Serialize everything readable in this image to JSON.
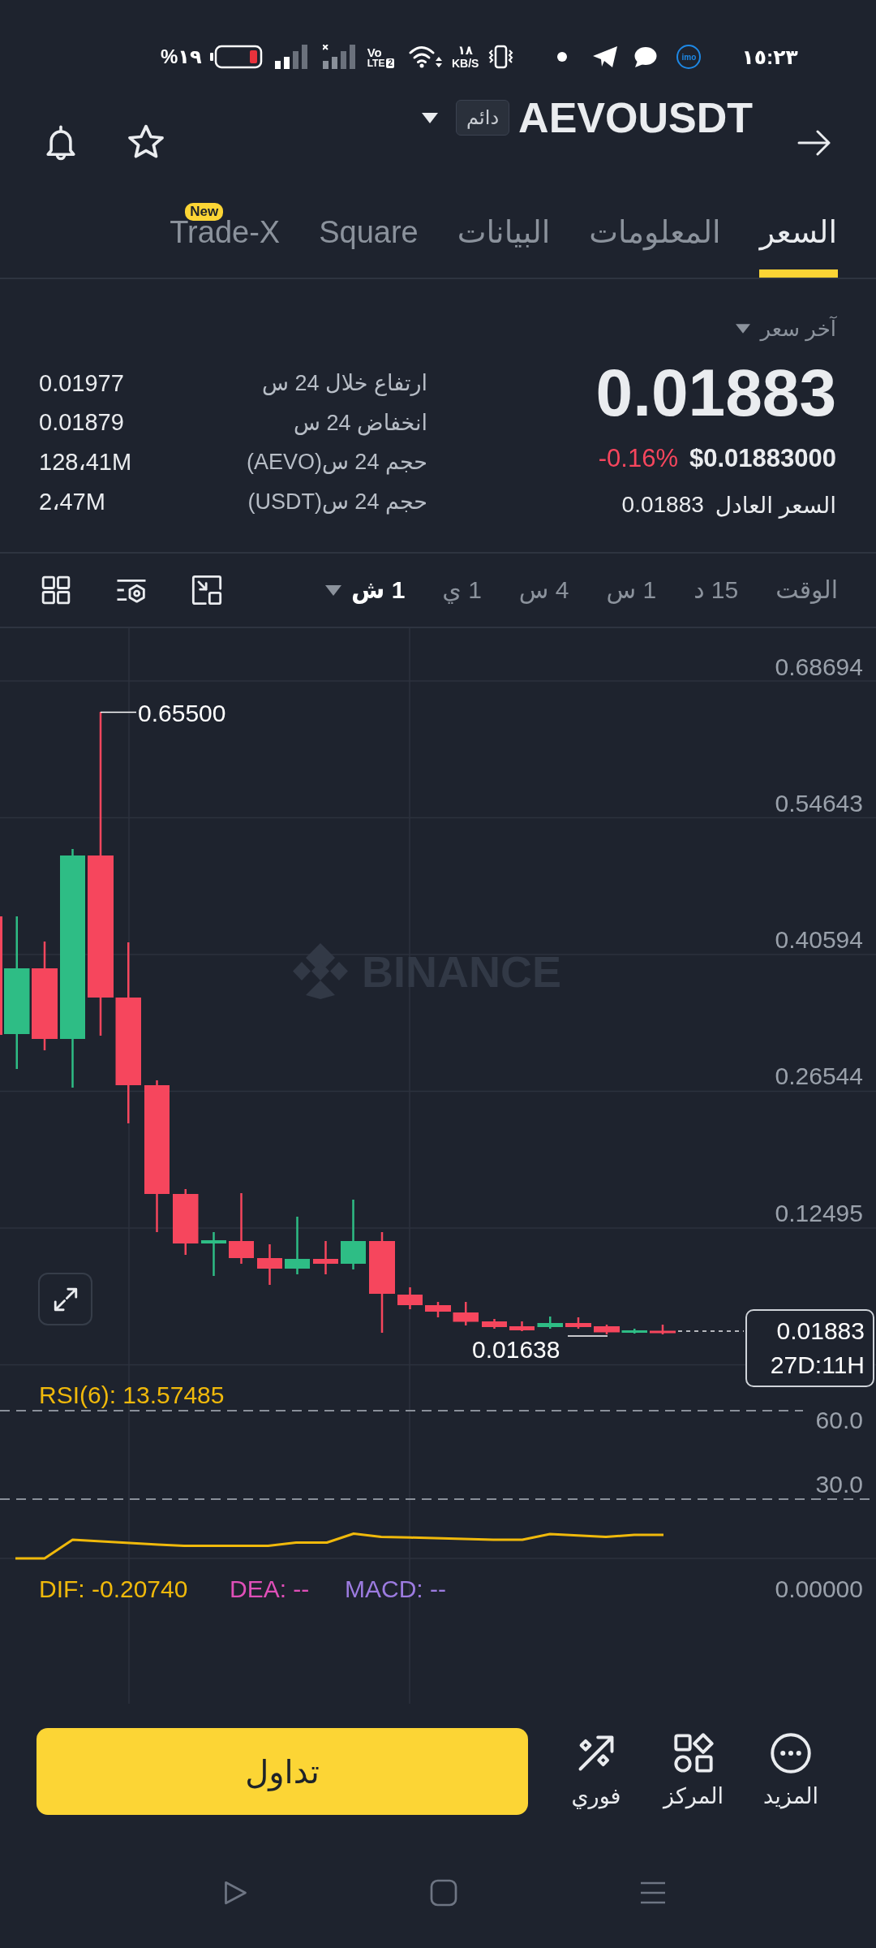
{
  "status_bar": {
    "battery_percent": "%١٩",
    "volte": {
      "top": "Vo",
      "bottom": "LTE",
      "sim": "2"
    },
    "net_speed": "١٨",
    "net_unit": "KB/S",
    "app_badge": "imo",
    "time": "١٥:٢٣"
  },
  "header": {
    "symbol": "AEVOUSDT",
    "contract_badge": "دائم"
  },
  "tabs": [
    {
      "label": "السعر",
      "selected": true
    },
    {
      "label": "المعلومات",
      "selected": false
    },
    {
      "label": "البيانات",
      "selected": false
    },
    {
      "label": "Square",
      "selected": false
    },
    {
      "label": "Trade-X",
      "selected": false,
      "badge": "New"
    }
  ],
  "price": {
    "selector": "آخر سعر",
    "last": "0.01883",
    "usd": "$0.01883000",
    "change": "-0.16%",
    "falling": true,
    "fair_label": "السعر العادل",
    "fair_value": "0.01883"
  },
  "stats": [
    {
      "label": "ارتفاع خلال 24 س",
      "value": "0.01977"
    },
    {
      "label": "انخفاض 24 س",
      "value": "0.01879"
    },
    {
      "label": "حجم 24 س(AEVO)",
      "value": "128،41M"
    },
    {
      "label": "حجم 24 س(USDT)",
      "value": "2،47M"
    }
  ],
  "timeframes": [
    {
      "label": "الوقت",
      "selected": false,
      "dropdown": false
    },
    {
      "label": "15 د",
      "selected": false,
      "dropdown": false
    },
    {
      "label": "1 س",
      "selected": false,
      "dropdown": false
    },
    {
      "label": "4 س",
      "selected": false,
      "dropdown": false
    },
    {
      "label": "1 ي",
      "selected": false,
      "dropdown": false
    },
    {
      "label": "1 ش",
      "selected": true,
      "dropdown": true
    }
  ],
  "chart": {
    "watermark": "BINANCE",
    "price_axis": [
      "0.68694",
      "0.54643",
      "0.40594",
      "0.26544",
      "0.12495"
    ],
    "high_marker": "0.65500",
    "low_marker": "0.01638",
    "last_price": "0.01883",
    "countdown": "27D:11H"
  },
  "rsi": {
    "label": "RSI(6): 13.57485",
    "axis": [
      "60.0",
      "30.0"
    ]
  },
  "macd": {
    "items": [
      {
        "label": "MACD: --",
        "color": "#9c7be0"
      },
      {
        "label": "DEA: --",
        "color": "#df4fb8"
      },
      {
        "label": "DIF: -0.20740",
        "color": "#f0b90b"
      }
    ],
    "axis": "0.00000"
  },
  "actions": [
    {
      "label": "المزيد",
      "kind": "more"
    },
    {
      "label": "المركز",
      "kind": "hub"
    },
    {
      "label": "فوري",
      "kind": "instant"
    }
  ],
  "trade_button": "تداول"
}
